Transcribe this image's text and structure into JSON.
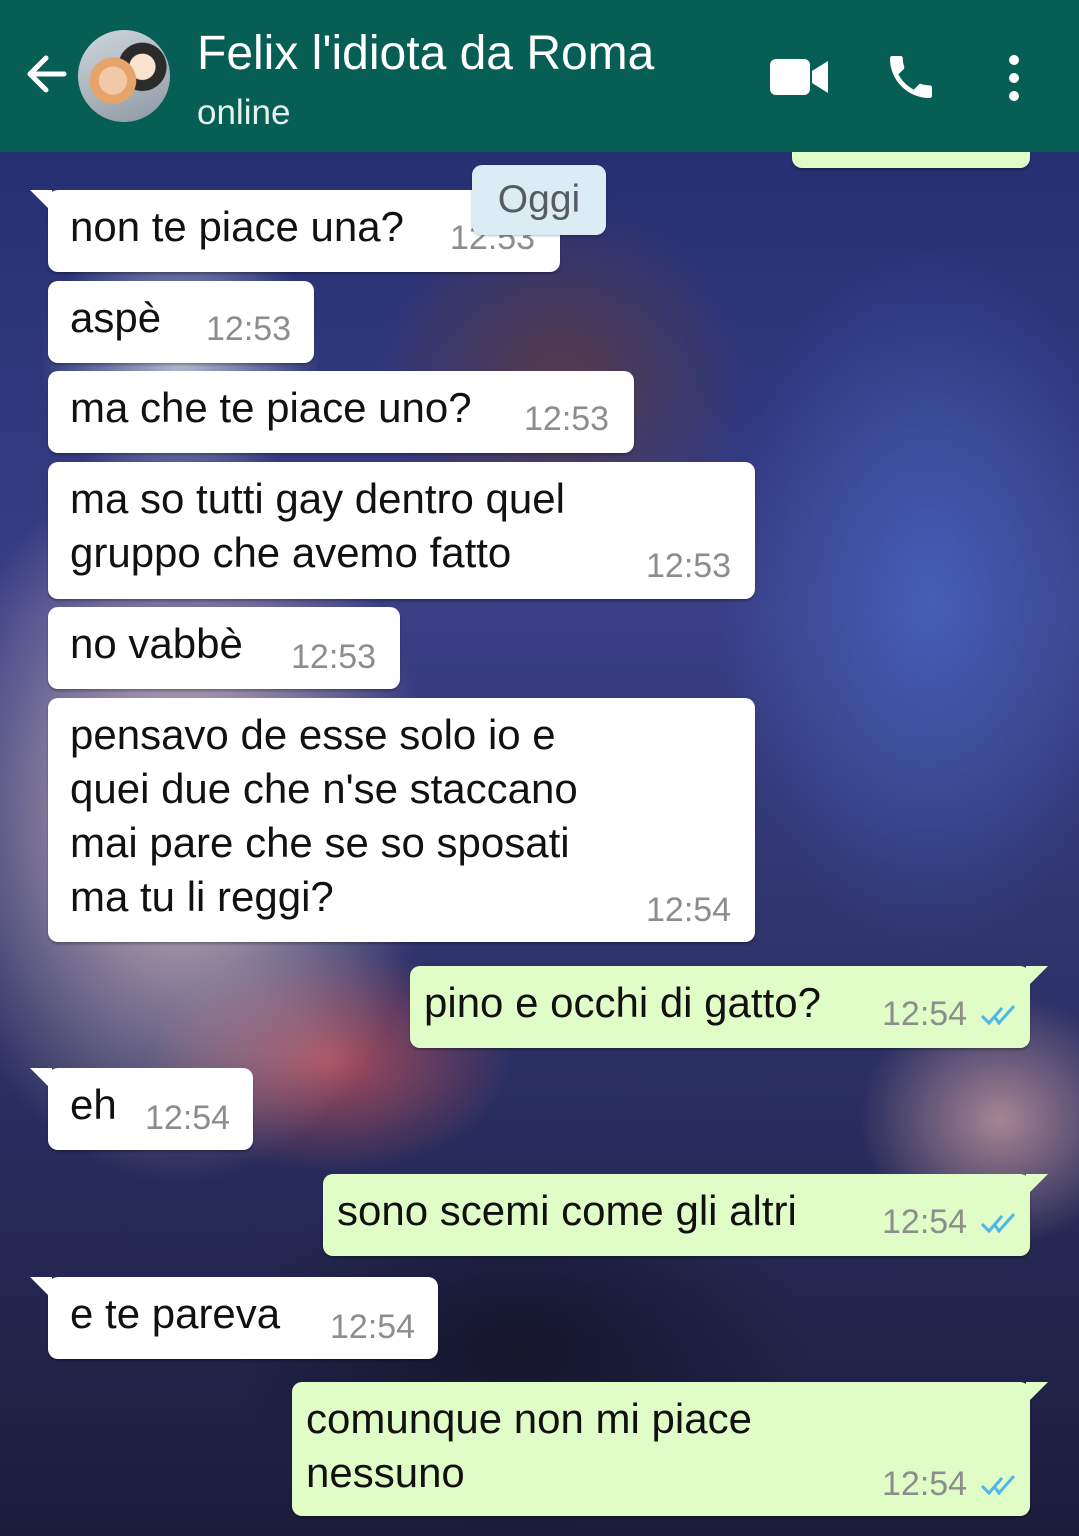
{
  "header": {
    "contact_name": "Felix l'idiota da Roma",
    "status": "online",
    "icons": [
      "back-arrow-icon",
      "video-call-icon",
      "phone-icon",
      "more-vert-icon"
    ],
    "color": "#075e54"
  },
  "date_chip": "Oggi",
  "messages": [
    {
      "dir": "in",
      "text": "non te piace una?",
      "time": "12:53"
    },
    {
      "dir": "in",
      "text": "aspè",
      "time": "12:53"
    },
    {
      "dir": "in",
      "text": "ma che te piace uno?",
      "time": "12:53"
    },
    {
      "dir": "in",
      "text": "ma so tutti gay dentro quel\ngruppo che avemo fatto",
      "time": "12:53"
    },
    {
      "dir": "in",
      "text": "no vabbè",
      "time": "12:53"
    },
    {
      "dir": "in",
      "text": "pensavo de esse solo io e\nquei due che n'se staccano\nmai pare che se so sposati\nma tu li reggi?",
      "time": "12:54"
    },
    {
      "dir": "out",
      "text": "pino e occhi di gatto?",
      "time": "12:54",
      "read": true
    },
    {
      "dir": "in",
      "text": "eh",
      "time": "12:54"
    },
    {
      "dir": "out",
      "text": "sono scemi come gli altri",
      "time": "12:54",
      "read": true
    },
    {
      "dir": "in",
      "text": "e te pareva",
      "time": "12:54"
    },
    {
      "dir": "out",
      "text": "comunque non mi piace\nnessuno",
      "time": "12:54",
      "read": true
    }
  ],
  "colors": {
    "incoming": "#ffffff",
    "outgoing": "#e1fdc7",
    "read_ticks": "#4fb6ec"
  }
}
